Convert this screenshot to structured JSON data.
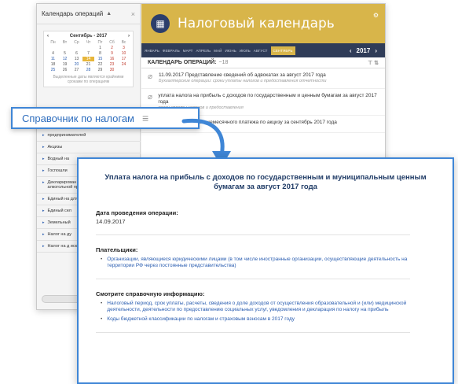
{
  "left_panel": {
    "title": "Календарь операций",
    "mini_calendar": {
      "month_label": "Сентябрь - 2017",
      "prev": "‹",
      "next": "›",
      "weekdays": [
        "Пн",
        "Вт",
        "Ср",
        "Чт",
        "Пт",
        "Сб",
        "Вс"
      ],
      "rows": [
        [
          "",
          "",
          "",
          "",
          "1",
          "2",
          "3"
        ],
        [
          "4",
          "5",
          "6",
          "7",
          "8",
          "9",
          "10"
        ],
        [
          "11",
          "12",
          "13",
          "14",
          "15",
          "16",
          "17"
        ],
        [
          "18",
          "19",
          "20",
          "21",
          "22",
          "23",
          "24"
        ],
        [
          "25",
          "26",
          "27",
          "28",
          "29",
          "30",
          ""
        ]
      ],
      "note": "Выделенные даты являются крайними сроками по операциям"
    },
    "items": [
      "предпринимателей",
      "Акцизы",
      "Водный на",
      "Госпошли",
      "Декларирован оборота алк спиртосодержа алкогольной продукции",
      "Единый на для отдель",
      "Единый сел",
      "Земельный",
      "Налог на ду",
      "Налог на д исключени"
    ]
  },
  "right_panel": {
    "title": "Налоговый календарь",
    "months": [
      "ЯНВАРЬ",
      "ФЕВРАЛЬ",
      "МАРТ",
      "АПРЕЛЬ",
      "МАЙ",
      "ИЮНЬ",
      "ИЮЛЬ",
      "АВГУСТ",
      "СЕНТЯБРЬ"
    ],
    "active_month": "СЕНТЯБРЬ",
    "year": "2017",
    "ops_header": "КАЛЕНДАРЬ ОПЕРАЦИЙ:",
    "ops_count": "~18",
    "operations": [
      {
        "text": "11.09.2017 Представление сведений об адвокатах за август 2017 года",
        "sub": "Бухгалтерские операции: сроки уплаты налогов и предоставления отчетности"
      },
      {
        "text": "уплата налога на прибыль с доходов по государственным и ценным бумагам за август 2017 года",
        "sub": "сроки уплаты налогов и предоставления"
      },
      {
        "text": "15.09.2017 Уплата ежемесячного платежа по акцизу за сентябрь 2017 года",
        "sub": ""
      }
    ]
  },
  "reference_tag": {
    "label": "Справочник по налогам",
    "menu_icon": "≡"
  },
  "detail": {
    "title": "Уплата налога на прибыль с доходов по государственным и муниципальным ценным бумагам за август 2017 года",
    "date_heading": "Дата проведения операции:",
    "date_value": "14.09.2017",
    "payers_heading": "Плательщики:",
    "payers": [
      "Организации, являющиеся юридическими лицами (в том числе иностранные организации, осуществляющие деятельность на территории РФ через постоянные представительства)"
    ],
    "see_heading": "Смотрите справочную информацию:",
    "links": [
      "Налоговый период, срок уплаты, расчеты, сведения о доле доходов от осуществления образовательной и (или) медицинской деятельности, деятельности по предоставлению социальных услуг, уведомления и декларация по налогу на прибыль",
      "Коды бюджетной классификации по налогам и страховым взносам в 2017 году"
    ]
  },
  "colors": {
    "accent_blue": "#3f86d6",
    "gold": "#d8b54a",
    "navy": "#2f3c58",
    "link": "#2a5db0"
  }
}
